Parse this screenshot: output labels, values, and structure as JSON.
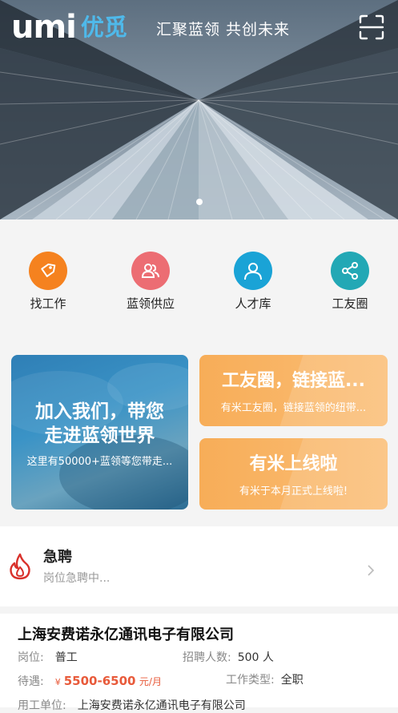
{
  "header": {
    "logo_latin": "umi",
    "logo_cn": "优觅",
    "slogan": "汇聚蓝领 共创未来",
    "scan_icon": "scan-icon"
  },
  "banner": {
    "slides": 1,
    "active_slide": 1
  },
  "quick_nav": [
    {
      "label": "找工作",
      "icon": "tag-icon",
      "color": "#f5821f"
    },
    {
      "label": "蓝领供应",
      "icon": "users-icon",
      "color": "#ec6d73"
    },
    {
      "label": "人才库",
      "icon": "person-icon",
      "color": "#1aa3d6"
    },
    {
      "label": "工友圈",
      "icon": "share-icon",
      "color": "#23a8b5"
    }
  ],
  "cards": {
    "left": {
      "title_line1": "加入我们，带您",
      "title_line2": "走进蓝领世界",
      "subtitle": "这里有50000+蓝领等您带走..."
    },
    "right_top": {
      "title": "工友圈，链接蓝...",
      "subtitle": "有米工友圈，链接蓝领的纽带..."
    },
    "right_bottom": {
      "title": "有米上线啦",
      "subtitle": "有米于本月正式上线啦!"
    }
  },
  "urgent": {
    "title": "急聘",
    "subtitle": "岗位急聘中..."
  },
  "job": {
    "company": "上海安费诺永亿通讯电子有限公司",
    "position_label": "岗位:",
    "position_value": "普工",
    "headcount_label": "招聘人数:",
    "headcount_value": "500 人",
    "pay_label": "待遇:",
    "pay_currency": "¥",
    "pay_value": "5500-6500",
    "pay_unit": "元/月",
    "type_label": "工作类型:",
    "type_value": "全职",
    "employer_label": "用工单位:",
    "employer_value": "上海安费诺永亿通讯电子有限公司"
  }
}
